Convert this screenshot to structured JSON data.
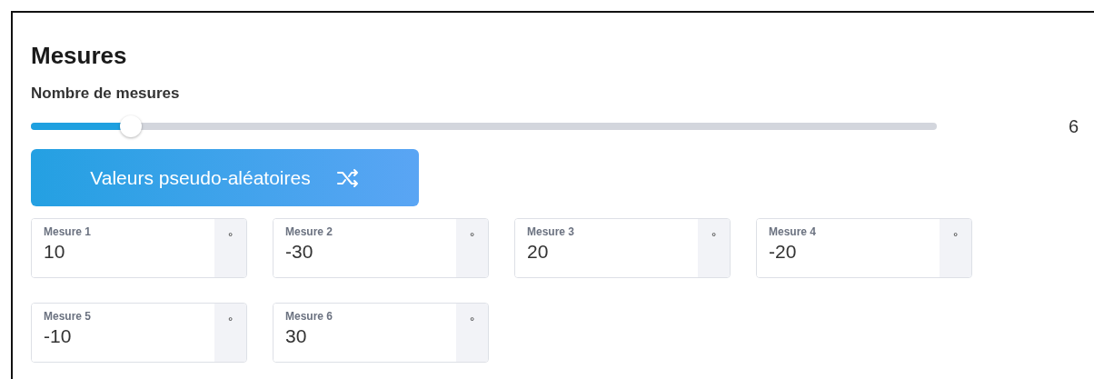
{
  "title": "Mesures",
  "slider": {
    "label": "Nombre de mesures",
    "level": 0.11,
    "reading": "6"
  },
  "random_button": {
    "label": "Valeurs pseudo-aléatoires"
  },
  "measures": [
    {
      "label": "Mesure 1",
      "value": "10",
      "unit": "°"
    },
    {
      "label": "Mesure 2",
      "value": "-30",
      "unit": "°"
    },
    {
      "label": "Mesure 3",
      "value": "20",
      "unit": "°"
    },
    {
      "label": "Mesure 4",
      "value": "-20",
      "unit": "°"
    },
    {
      "label": "Mesure 5",
      "value": "-10",
      "unit": "°"
    },
    {
      "label": "Mesure 6",
      "value": "30",
      "unit": "°"
    }
  ]
}
